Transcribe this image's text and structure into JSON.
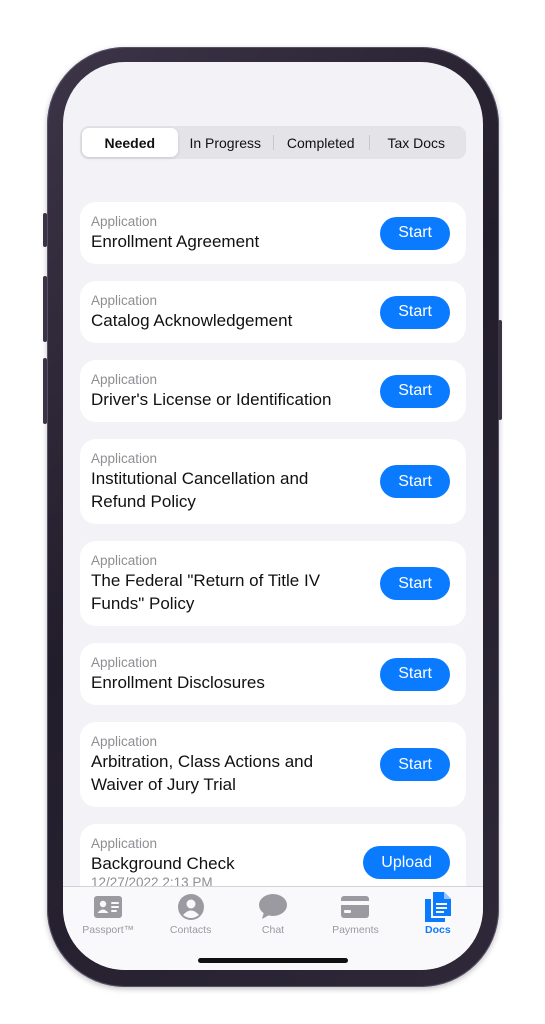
{
  "segments": [
    "Needed",
    "In Progress",
    "Completed",
    "Tax Docs"
  ],
  "documents": [
    {
      "category": "Application",
      "title_lines": [
        "Enrollment Agreement"
      ],
      "action": "Start"
    },
    {
      "category": "Application",
      "title_lines": [
        "Catalog Acknowledgement"
      ],
      "action": "Start"
    },
    {
      "category": "Application",
      "title_lines": [
        "Driver's License or Identification"
      ],
      "action": "Start"
    },
    {
      "category": "Application",
      "title_lines": [
        "Institutional Cancellation and",
        "Refund Policy"
      ],
      "action": "Start"
    },
    {
      "category": "Application",
      "title_lines": [
        "The Federal \"Return of Title IV",
        "Funds\" Policy"
      ],
      "action": "Start"
    },
    {
      "category": "Application",
      "title_lines": [
        "Enrollment Disclosures"
      ],
      "action": "Start"
    },
    {
      "category": "Application",
      "title_lines": [
        "Arbitration, Class Actions and",
        "Waiver of Jury Trial"
      ],
      "action": "Start"
    },
    {
      "category": "Application",
      "title_lines": [
        "Background Check"
      ],
      "date": "12/27/2022 2:13 PM",
      "action": "Upload"
    }
  ],
  "tab_bar": {
    "tabs": [
      {
        "label": "Passport™",
        "icon": "id-card-icon"
      },
      {
        "label": "Contacts",
        "icon": "person-icon"
      },
      {
        "label": "Chat",
        "icon": "chat-bubble-icon"
      },
      {
        "label": "Payments",
        "icon": "credit-card-icon"
      },
      {
        "label": "Docs",
        "icon": "documents-icon"
      }
    ]
  },
  "colors": {
    "accent": "#0a7bff",
    "inactive": "#9a9aa0",
    "background": "#f2f2f7"
  }
}
